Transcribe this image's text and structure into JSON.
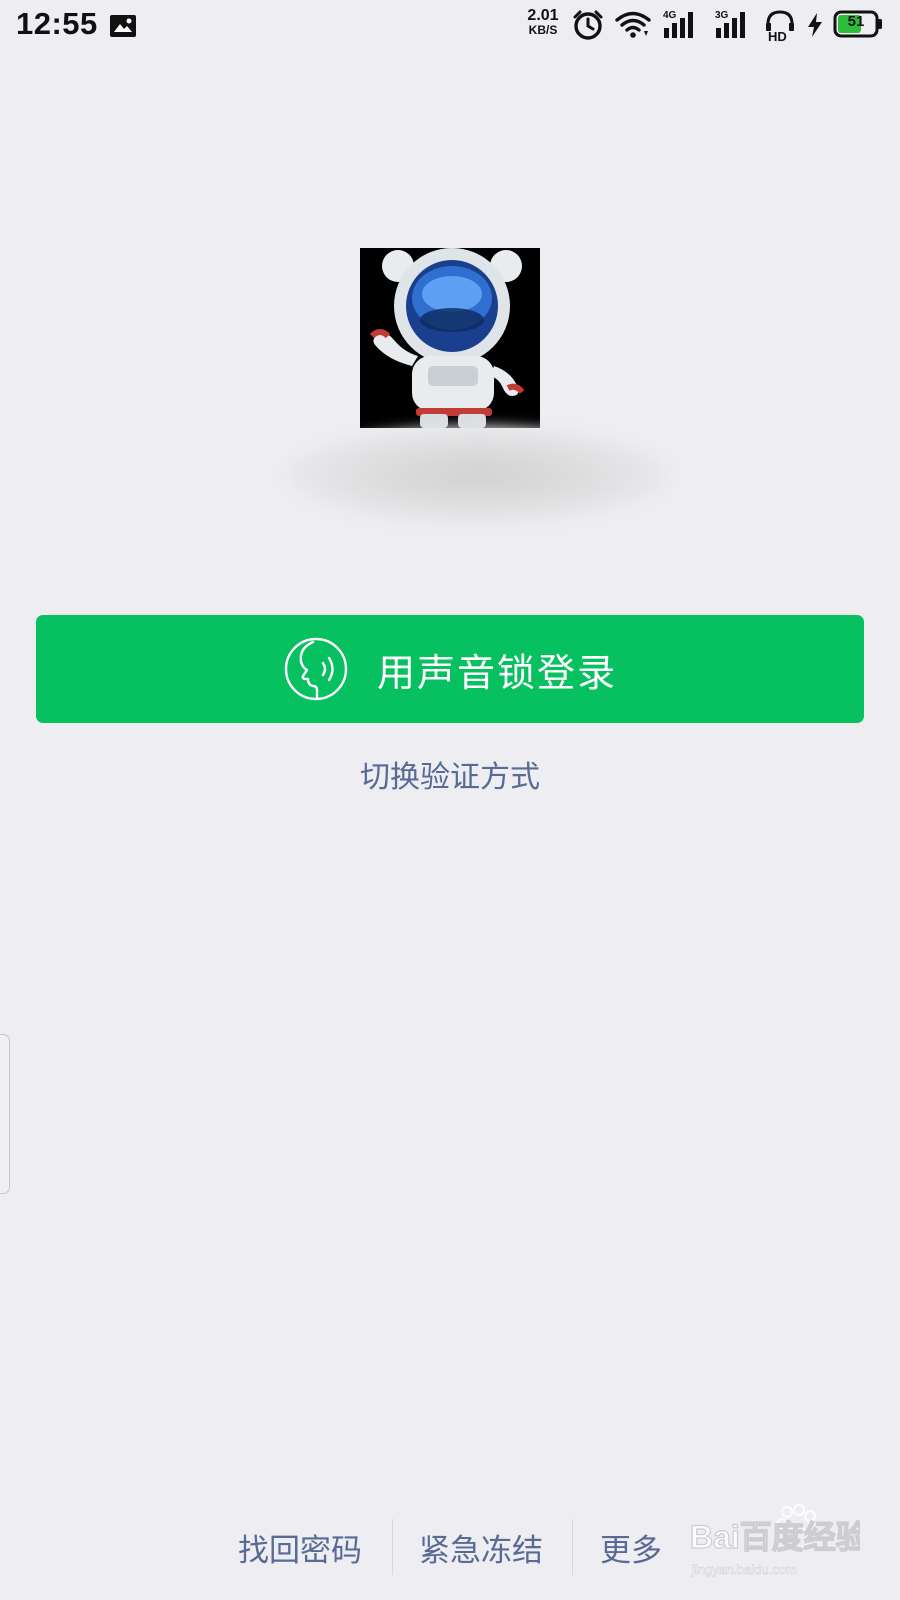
{
  "status_bar": {
    "time": "12:55",
    "net_speed_value": "2.01",
    "net_speed_unit": "KB/S",
    "signal_1_label": "4G",
    "signal_2_label": "3G",
    "hd_label": "HD",
    "battery": "51",
    "icons": [
      "image-notification-icon",
      "alarm-icon",
      "wifi-icon",
      "signal-4g-icon",
      "signal-3g-icon",
      "hd-voice-icon",
      "charging-icon",
      "battery-icon"
    ]
  },
  "profile": {
    "avatar": "astronaut-avatar"
  },
  "login": {
    "voice_button_label": "用声音锁登录",
    "voice_icon": "voice-face-icon",
    "switch_method_label": "切换验证方式"
  },
  "footer": {
    "links": [
      "找回密码",
      "紧急冻结",
      "更多"
    ]
  },
  "watermark": {
    "brand": "Bai百度经验",
    "url": "jingyan.baidu.com"
  },
  "colors": {
    "background": "#EEEDF1",
    "primary_green": "#07C160",
    "link_blue": "#576B95"
  }
}
